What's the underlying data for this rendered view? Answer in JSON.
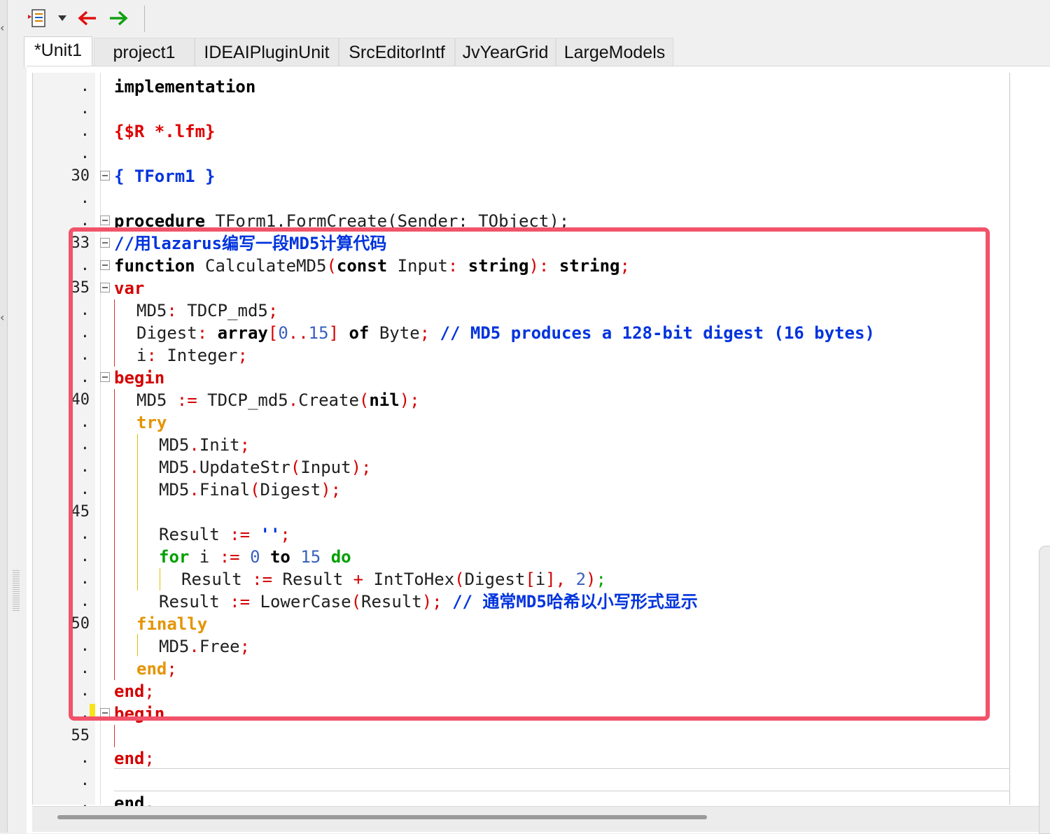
{
  "toolbar": {
    "icons": [
      "document-list-icon",
      "dropdown-arrow-icon",
      "back-arrow-icon",
      "forward-arrow-icon"
    ]
  },
  "tabs": [
    {
      "label": "*Unit1",
      "active": true
    },
    {
      "label": "project1",
      "active": false
    },
    {
      "label": "IDEAIPluginUnit",
      "active": false
    },
    {
      "label": "SrcEditorIntf",
      "active": false
    },
    {
      "label": "JvYearGrid",
      "active": false
    },
    {
      "label": "LargeModels",
      "active": false
    }
  ],
  "gutter": {
    "numbers": [
      ".",
      ".",
      ".",
      ".",
      "30",
      ".",
      ".",
      "33",
      ".",
      "35",
      ".",
      ".",
      ".",
      ".",
      "40",
      ".",
      ".",
      ".",
      ".",
      "45",
      ".",
      ".",
      ".",
      ".",
      "50",
      ".",
      ".",
      ".",
      ".",
      "55",
      ".",
      ".",
      "."
    ]
  },
  "code": {
    "line_implementation": "implementation",
    "line_directive": "{$R *.lfm}",
    "line_tform_comment": "{ TForm1 }",
    "line_procedure_kw": "procedure",
    "line_procedure_rest": " TForm1.FormCreate(Sender: TObject);",
    "line_cn_comment": "//用lazarus编写一段MD5计算代码",
    "line_function_kw": "function",
    "line_function_name": " CalculateMD5",
    "line_function_const": "const",
    "line_function_input": " Input",
    "line_string": "string",
    "line_var": "var",
    "line_md5_decl": "MD5",
    "line_md5_type": " TDCP_md5",
    "line_digest": "Digest",
    "line_array": "array",
    "line_range_start": "0",
    "line_range_end": "15",
    "line_of": "of",
    "line_byte": " Byte",
    "line_digest_comment": "// MD5 produces a 128-bit digest (16 bytes)",
    "line_i": "i",
    "line_integer": " Integer",
    "line_begin": "begin",
    "line_create_md5": "MD5 ",
    "line_create_assign": ":=",
    "line_create_rest": " TDCP_md5",
    "line_create_fn": "Create",
    "line_nil": "nil",
    "line_try": "try",
    "line_init_obj": "MD5",
    "line_init_fn": "Init",
    "line_update_fn": "UpdateStr",
    "line_update_arg": "Input",
    "line_final_fn": "Final",
    "line_final_arg": "Digest",
    "line_result": "Result ",
    "line_empty_str": "''",
    "line_for": "for",
    "line_i_var": " i ",
    "line_zero": "0",
    "line_to": "to",
    "line_fifteen": "15",
    "line_do": "do",
    "line_result_inner": "Result ",
    "line_result_inner2": " Result ",
    "line_inttohex": " IntToHex",
    "line_digest_arg": "Digest",
    "line_idx": "i",
    "line_two": "2",
    "line_lowercase": " LowerCase",
    "line_result_arg": "Result",
    "line_lower_comment": "// 通常MD5哈希以小写形式显示",
    "line_finally": "finally",
    "line_free_fn": "Free",
    "line_end": "end",
    "line_end_dot": "end."
  },
  "colors": {
    "highlight_box": "#f2526a",
    "keyword_red": "#d40000",
    "keyword_orange": "#e49400",
    "keyword_green": "#00a000",
    "comment_blue": "#0033dd"
  }
}
